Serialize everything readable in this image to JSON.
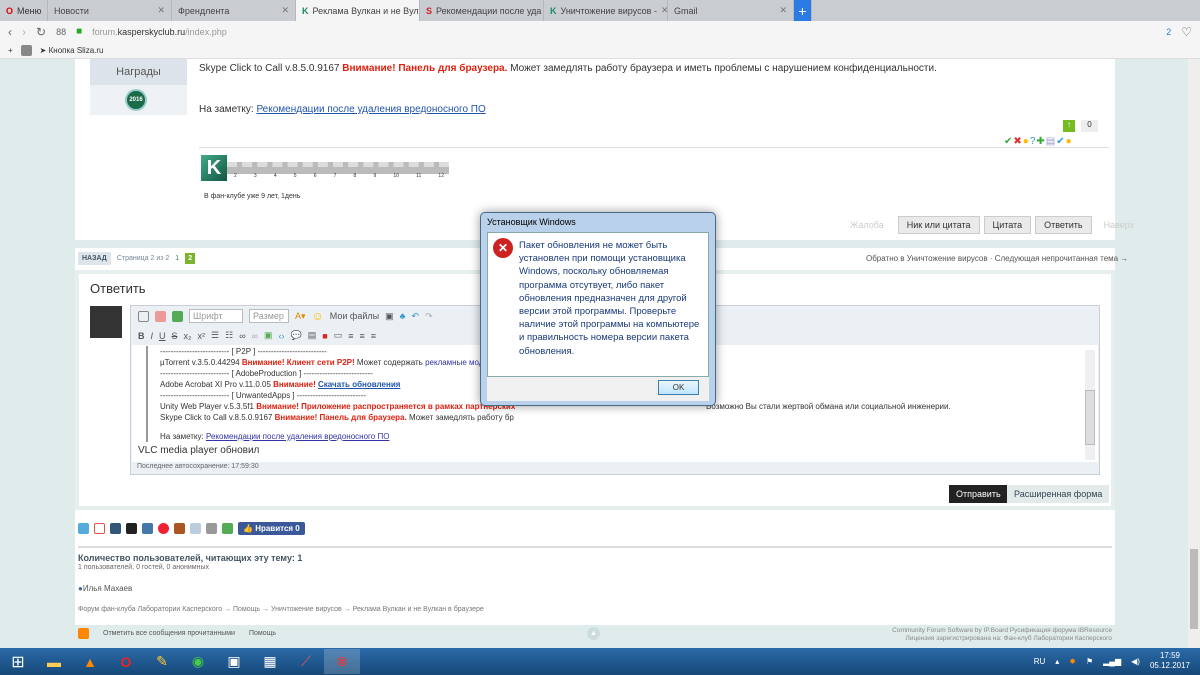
{
  "browser": {
    "menu": "Меню",
    "tabs": [
      {
        "label": "Новости"
      },
      {
        "label": "Френдлента"
      },
      {
        "label": "Реклама Вулкан и не Вул"
      },
      {
        "label": "Рекомендации после уда"
      },
      {
        "label": "Уничтожение вирусов -"
      },
      {
        "label": "Gmail"
      }
    ],
    "url_prefix": "forum.",
    "url_domain": "kasperskyclub.ru",
    "url_path": "/index.php",
    "bookmark": "Кнопка Sliza.ru",
    "badge_count": "2"
  },
  "post": {
    "awards_label": "Награды",
    "badge": "2016",
    "line1_a": "Skype Click to Call v.8.5.0.9167",
    "line1_warn": "Внимание! Панель для браузера.",
    "line1_b": "Может замедлять работу браузера и иметь проблемы с нарушением конфиденциальности.",
    "note_label": "На заметку:",
    "note_link": "Рекомендации после удаления вредоносного ПО",
    "vote": "0",
    "club_years": "В фан-клубе уже 9 лет, 1день",
    "ruler": [
      "2",
      "3",
      "4",
      "5",
      "6",
      "7",
      "8",
      "9",
      "10",
      "11",
      "12"
    ],
    "actions": {
      "report": "Жалоба",
      "nick_quote": "Ник или цитата",
      "quote": "Цитата",
      "reply": "Ответить",
      "top": "Наверх"
    }
  },
  "pager": {
    "back": "НАЗАД",
    "page_info": "Страница 2 из 2",
    "p1": "1",
    "p2": "2",
    "back_to": "Обратно в Уничтожение вирусов",
    "next": "Следующая непрочитанная тема →"
  },
  "reply": {
    "title": "Ответить",
    "font": "Шрифт",
    "size": "Размер",
    "my_files": "Мои файлы",
    "lines": {
      "p2p": "-------------------------- [ P2P ] --------------------------",
      "ut_a": "µTorrent v.3.5.0.44294",
      "ut_warn": "Внимание! Клиент сети P2P!",
      "ut_b": "Может содержать",
      "ut_link": "рекламные модули или",
      "adobe_h": "-------------------------- [ AdobeProduction ] --------------------------",
      "adobe_a": "Adobe Acrobat XI Pro v.11.0.05",
      "adobe_warn": "Внимание!",
      "adobe_link": "Скачать обновления",
      "unw_h": "-------------------------- [ UnwantedApps ] --------------------------",
      "unity_a": "Unity Web Player v.5.3.5f1",
      "unity_warn": "Внимание! Приложение распространяется в рамках партнерских",
      "unity_b": "Возможно Вы стали жертвой обмана или социальной инженерии.",
      "skype_a": "Skype Click to Call v.8.5.0.9167",
      "skype_warn": "Внимание! Панель для браузера.",
      "skype_b": "Может замедлять работу бр",
      "note_label": "На заметку:",
      "note_link": "Рекомендации после удаления вредоносного ПО"
    },
    "typed": "VLC media player обновил",
    "autosave": "Последнее автосохранение: 17:59:30",
    "send": "Отправить",
    "advanced": "Расширенная форма"
  },
  "like": "Нравится 0",
  "readers": {
    "title": "Количество пользователей, читающих эту тему: 1",
    "detail": "1 пользователей, 0 гостей, 0 анонимных",
    "user": "Илья Махаев"
  },
  "breadcrumb": [
    "Форум фан-клуба Лаборатории Касперского",
    "Помощь",
    "Уничтожение вирусов",
    "Реклама Вулкан и не Вулкан в браузере"
  ],
  "footer": {
    "mark_read": "Отметить все сообщения прочитанными",
    "help": "Помощь",
    "credit1": "Community Forum Software by IP.Board Русификация форума IBResource",
    "credit2": "Лицензия зарегистрирована на: Фан-клуб Лаборатории Касперского"
  },
  "dialog": {
    "title": "Установщик Windows",
    "message": "Пакет обновления не может быть установлен при помощи установщика Windows, поскольку обновляемая программа отсутвует, либо пакет обновления предназначен для другой версии этой программы. Проверьте наличие этой программы на компьютере и правильность номера версии пакета обновления.",
    "ok": "OK"
  },
  "taskbar": {
    "lang": "RU",
    "time": "17:59",
    "date": "05.12.2017"
  }
}
